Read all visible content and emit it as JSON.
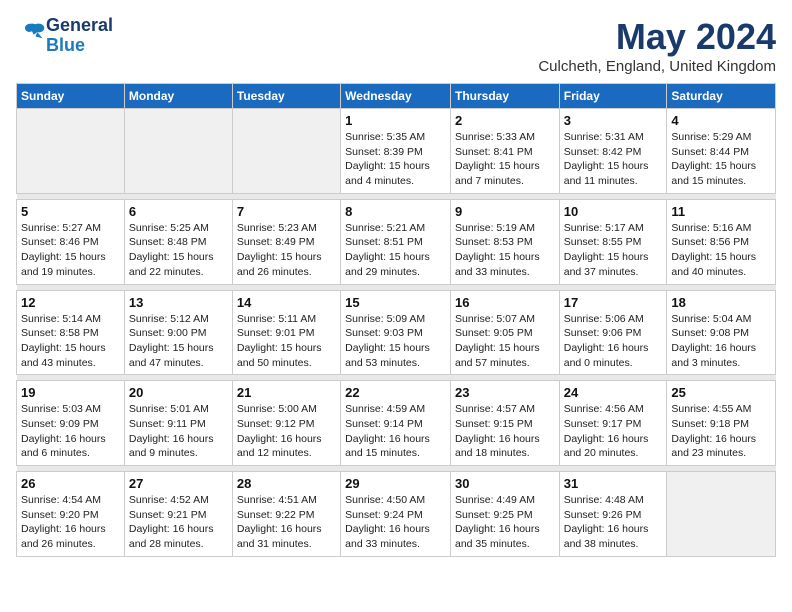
{
  "header": {
    "logo_line1": "General",
    "logo_line2": "Blue",
    "month": "May 2024",
    "location": "Culcheth, England, United Kingdom"
  },
  "days_of_week": [
    "Sunday",
    "Monday",
    "Tuesday",
    "Wednesday",
    "Thursday",
    "Friday",
    "Saturday"
  ],
  "weeks": [
    [
      {
        "num": "",
        "info": ""
      },
      {
        "num": "",
        "info": ""
      },
      {
        "num": "",
        "info": ""
      },
      {
        "num": "1",
        "info": "Sunrise: 5:35 AM\nSunset: 8:39 PM\nDaylight: 15 hours\nand 4 minutes."
      },
      {
        "num": "2",
        "info": "Sunrise: 5:33 AM\nSunset: 8:41 PM\nDaylight: 15 hours\nand 7 minutes."
      },
      {
        "num": "3",
        "info": "Sunrise: 5:31 AM\nSunset: 8:42 PM\nDaylight: 15 hours\nand 11 minutes."
      },
      {
        "num": "4",
        "info": "Sunrise: 5:29 AM\nSunset: 8:44 PM\nDaylight: 15 hours\nand 15 minutes."
      }
    ],
    [
      {
        "num": "5",
        "info": "Sunrise: 5:27 AM\nSunset: 8:46 PM\nDaylight: 15 hours\nand 19 minutes."
      },
      {
        "num": "6",
        "info": "Sunrise: 5:25 AM\nSunset: 8:48 PM\nDaylight: 15 hours\nand 22 minutes."
      },
      {
        "num": "7",
        "info": "Sunrise: 5:23 AM\nSunset: 8:49 PM\nDaylight: 15 hours\nand 26 minutes."
      },
      {
        "num": "8",
        "info": "Sunrise: 5:21 AM\nSunset: 8:51 PM\nDaylight: 15 hours\nand 29 minutes."
      },
      {
        "num": "9",
        "info": "Sunrise: 5:19 AM\nSunset: 8:53 PM\nDaylight: 15 hours\nand 33 minutes."
      },
      {
        "num": "10",
        "info": "Sunrise: 5:17 AM\nSunset: 8:55 PM\nDaylight: 15 hours\nand 37 minutes."
      },
      {
        "num": "11",
        "info": "Sunrise: 5:16 AM\nSunset: 8:56 PM\nDaylight: 15 hours\nand 40 minutes."
      }
    ],
    [
      {
        "num": "12",
        "info": "Sunrise: 5:14 AM\nSunset: 8:58 PM\nDaylight: 15 hours\nand 43 minutes."
      },
      {
        "num": "13",
        "info": "Sunrise: 5:12 AM\nSunset: 9:00 PM\nDaylight: 15 hours\nand 47 minutes."
      },
      {
        "num": "14",
        "info": "Sunrise: 5:11 AM\nSunset: 9:01 PM\nDaylight: 15 hours\nand 50 minutes."
      },
      {
        "num": "15",
        "info": "Sunrise: 5:09 AM\nSunset: 9:03 PM\nDaylight: 15 hours\nand 53 minutes."
      },
      {
        "num": "16",
        "info": "Sunrise: 5:07 AM\nSunset: 9:05 PM\nDaylight: 15 hours\nand 57 minutes."
      },
      {
        "num": "17",
        "info": "Sunrise: 5:06 AM\nSunset: 9:06 PM\nDaylight: 16 hours\nand 0 minutes."
      },
      {
        "num": "18",
        "info": "Sunrise: 5:04 AM\nSunset: 9:08 PM\nDaylight: 16 hours\nand 3 minutes."
      }
    ],
    [
      {
        "num": "19",
        "info": "Sunrise: 5:03 AM\nSunset: 9:09 PM\nDaylight: 16 hours\nand 6 minutes."
      },
      {
        "num": "20",
        "info": "Sunrise: 5:01 AM\nSunset: 9:11 PM\nDaylight: 16 hours\nand 9 minutes."
      },
      {
        "num": "21",
        "info": "Sunrise: 5:00 AM\nSunset: 9:12 PM\nDaylight: 16 hours\nand 12 minutes."
      },
      {
        "num": "22",
        "info": "Sunrise: 4:59 AM\nSunset: 9:14 PM\nDaylight: 16 hours\nand 15 minutes."
      },
      {
        "num": "23",
        "info": "Sunrise: 4:57 AM\nSunset: 9:15 PM\nDaylight: 16 hours\nand 18 minutes."
      },
      {
        "num": "24",
        "info": "Sunrise: 4:56 AM\nSunset: 9:17 PM\nDaylight: 16 hours\nand 20 minutes."
      },
      {
        "num": "25",
        "info": "Sunrise: 4:55 AM\nSunset: 9:18 PM\nDaylight: 16 hours\nand 23 minutes."
      }
    ],
    [
      {
        "num": "26",
        "info": "Sunrise: 4:54 AM\nSunset: 9:20 PM\nDaylight: 16 hours\nand 26 minutes."
      },
      {
        "num": "27",
        "info": "Sunrise: 4:52 AM\nSunset: 9:21 PM\nDaylight: 16 hours\nand 28 minutes."
      },
      {
        "num": "28",
        "info": "Sunrise: 4:51 AM\nSunset: 9:22 PM\nDaylight: 16 hours\nand 31 minutes."
      },
      {
        "num": "29",
        "info": "Sunrise: 4:50 AM\nSunset: 9:24 PM\nDaylight: 16 hours\nand 33 minutes."
      },
      {
        "num": "30",
        "info": "Sunrise: 4:49 AM\nSunset: 9:25 PM\nDaylight: 16 hours\nand 35 minutes."
      },
      {
        "num": "31",
        "info": "Sunrise: 4:48 AM\nSunset: 9:26 PM\nDaylight: 16 hours\nand 38 minutes."
      },
      {
        "num": "",
        "info": ""
      }
    ]
  ]
}
